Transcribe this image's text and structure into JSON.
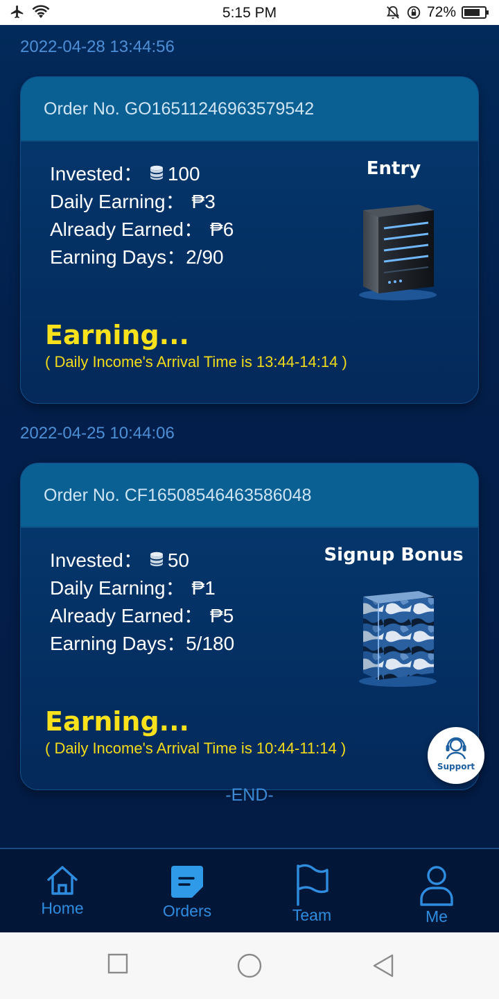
{
  "status_bar": {
    "time": "5:15 PM",
    "battery": "72%",
    "icons": [
      "airplane-icon",
      "wifi-icon",
      "bell-off-icon",
      "rotation-lock-icon",
      "battery-icon"
    ]
  },
  "orders": [
    {
      "date": "2022-04-28 13:44:56",
      "order_no": "Order No. GO16511246963579542",
      "invested_label": "Invested：",
      "invested_value": "100",
      "daily_label": "Daily Earning：",
      "daily_value": "₱3",
      "earned_label": "Already Earned：",
      "earned_value": "₱6",
      "days_label": "Earning Days：",
      "days_value": "2/90",
      "plan": "Entry",
      "status": "Earning...",
      "arrival": "( Daily Income's Arrival Time is 13:44-14:14 )",
      "image": "server-dark-icon"
    },
    {
      "date": "2022-04-25 10:44:06",
      "order_no": "Order No. CF16508546463586048",
      "invested_label": "Invested：",
      "invested_value": "50",
      "daily_label": "Daily Earning：",
      "daily_value": "₱1",
      "earned_label": "Already Earned：",
      "earned_value": "₱5",
      "days_label": "Earning Days：",
      "days_value": "5/180",
      "plan": "Signup Bonus",
      "status": "Earning...",
      "arrival": "( Daily Income's Arrival Time is 10:44-11:14 )",
      "image": "server-camo-icon"
    }
  ],
  "end_text": "-END-",
  "support_label": "Support",
  "nav": [
    {
      "label": "Home",
      "icon": "home-icon"
    },
    {
      "label": "Orders",
      "icon": "orders-icon"
    },
    {
      "label": "Team",
      "icon": "flag-icon"
    },
    {
      "label": "Me",
      "icon": "user-icon"
    }
  ],
  "colors": {
    "background": "#031e49",
    "card_header": "#0a6093",
    "status_yellow": "#f9e21b",
    "accent_blue": "#2f8de0"
  }
}
